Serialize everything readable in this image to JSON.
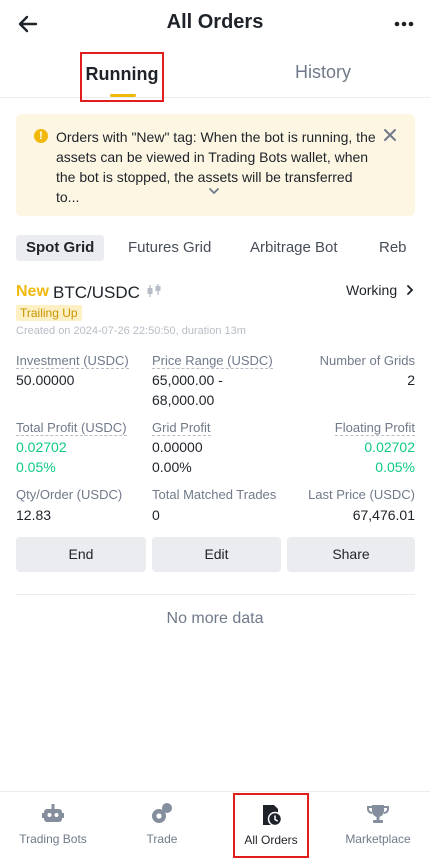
{
  "header": {
    "title": "All Orders"
  },
  "tabs": {
    "running": "Running",
    "history": "History"
  },
  "notice": {
    "text": "Orders with \"New\" tag: When the bot is running, the assets can be viewed in Trading Bots wallet, when the bot is stopped, the assets will be transferred to..."
  },
  "subtabs": [
    "Spot Grid",
    "Futures Grid",
    "Arbitrage Bot",
    "Reb"
  ],
  "order": {
    "new_tag": "New",
    "pair": "BTC/USDC",
    "status": "Working",
    "trailing": "Trailing Up",
    "created": "Created on 2024-07-26 22:50:50, duration 13m",
    "investment_label": "Investment (USDC)",
    "investment_value": "50.00000",
    "price_range_label": "Price Range (USDC)",
    "price_range_low": "65,000.00 -",
    "price_range_high": "68,000.00",
    "grids_label": "Number of Grids",
    "grids_value": "2",
    "total_profit_label": "Total Profit (USDC)",
    "total_profit_value": "0.02702",
    "total_profit_pct": "0.05%",
    "grid_profit_label": "Grid Profit",
    "grid_profit_value": "0.00000",
    "grid_profit_pct": "0.00%",
    "floating_profit_label": "Floating Profit",
    "floating_profit_value": "0.02702",
    "floating_profit_pct": "0.05%",
    "qty_label": "Qty/Order (USDC)",
    "qty_value": "12.83",
    "matched_label": "Total Matched Trades",
    "matched_value": "0",
    "last_price_label": "Last Price (USDC)",
    "last_price_value": "67,476.01"
  },
  "buttons": {
    "end": "End",
    "edit": "Edit",
    "share": "Share"
  },
  "footer_text": "No more data",
  "bottom_nav": {
    "trading_bots": "Trading Bots",
    "trade": "Trade",
    "all_orders": "All Orders",
    "marketplace": "Marketplace"
  },
  "colors": {
    "accent": "#f0b90b",
    "profit": "#0ecb81",
    "highlight": "#e11d1d"
  }
}
